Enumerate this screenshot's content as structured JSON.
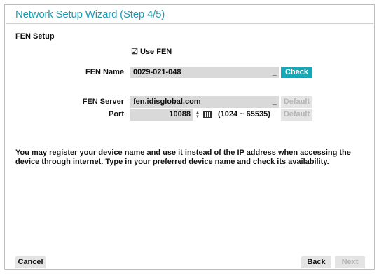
{
  "wizard": {
    "title": "Network Setup Wizard (Step 4/5)",
    "section_title": "FEN Setup",
    "use_fen": {
      "label": "Use FEN",
      "checked": true
    },
    "fen_name": {
      "label": "FEN Name",
      "value": "0029-021-048",
      "check_button": "Check"
    },
    "fen_server": {
      "label": "FEN Server",
      "value": "fen.idisglobal.com",
      "default_button": "Default"
    },
    "port": {
      "label": "Port",
      "value": "10088",
      "range": "(1024 ~ 65535)",
      "default_button": "Default"
    },
    "description": "You may register your device name and use it instead of the IP address when accessing the device through internet. Type in your preferred device name and check its availability.",
    "footer": {
      "cancel": "Cancel",
      "back": "Back",
      "next": "Next"
    }
  },
  "colors": {
    "accent": "#16a8b7",
    "title": "#1a9bb5",
    "field_bg": "#d9d9d9",
    "disabled_text": "#b5b5b5"
  },
  "icons": {
    "checkbox": "checkmark-icon",
    "stepper": "spin-arrows-icon",
    "keyboard": "keyboard-icon"
  }
}
